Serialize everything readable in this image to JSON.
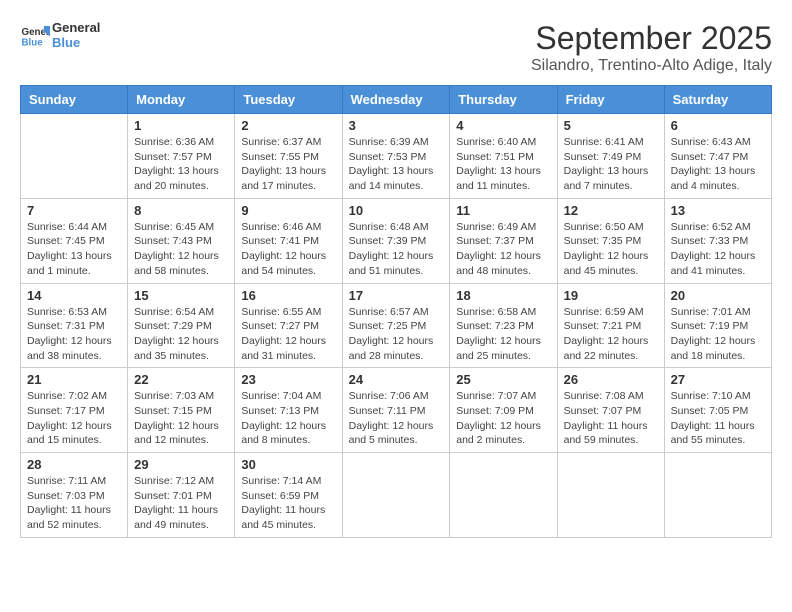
{
  "header": {
    "logo_line1": "General",
    "logo_line2": "Blue",
    "month_title": "September 2025",
    "subtitle": "Silandro, Trentino-Alto Adige, Italy"
  },
  "days_of_week": [
    "Sunday",
    "Monday",
    "Tuesday",
    "Wednesday",
    "Thursday",
    "Friday",
    "Saturday"
  ],
  "weeks": [
    [
      {
        "day": "",
        "info": ""
      },
      {
        "day": "1",
        "info": "Sunrise: 6:36 AM\nSunset: 7:57 PM\nDaylight: 13 hours\nand 20 minutes."
      },
      {
        "day": "2",
        "info": "Sunrise: 6:37 AM\nSunset: 7:55 PM\nDaylight: 13 hours\nand 17 minutes."
      },
      {
        "day": "3",
        "info": "Sunrise: 6:39 AM\nSunset: 7:53 PM\nDaylight: 13 hours\nand 14 minutes."
      },
      {
        "day": "4",
        "info": "Sunrise: 6:40 AM\nSunset: 7:51 PM\nDaylight: 13 hours\nand 11 minutes."
      },
      {
        "day": "5",
        "info": "Sunrise: 6:41 AM\nSunset: 7:49 PM\nDaylight: 13 hours\nand 7 minutes."
      },
      {
        "day": "6",
        "info": "Sunrise: 6:43 AM\nSunset: 7:47 PM\nDaylight: 13 hours\nand 4 minutes."
      }
    ],
    [
      {
        "day": "7",
        "info": "Sunrise: 6:44 AM\nSunset: 7:45 PM\nDaylight: 13 hours\nand 1 minute."
      },
      {
        "day": "8",
        "info": "Sunrise: 6:45 AM\nSunset: 7:43 PM\nDaylight: 12 hours\nand 58 minutes."
      },
      {
        "day": "9",
        "info": "Sunrise: 6:46 AM\nSunset: 7:41 PM\nDaylight: 12 hours\nand 54 minutes."
      },
      {
        "day": "10",
        "info": "Sunrise: 6:48 AM\nSunset: 7:39 PM\nDaylight: 12 hours\nand 51 minutes."
      },
      {
        "day": "11",
        "info": "Sunrise: 6:49 AM\nSunset: 7:37 PM\nDaylight: 12 hours\nand 48 minutes."
      },
      {
        "day": "12",
        "info": "Sunrise: 6:50 AM\nSunset: 7:35 PM\nDaylight: 12 hours\nand 45 minutes."
      },
      {
        "day": "13",
        "info": "Sunrise: 6:52 AM\nSunset: 7:33 PM\nDaylight: 12 hours\nand 41 minutes."
      }
    ],
    [
      {
        "day": "14",
        "info": "Sunrise: 6:53 AM\nSunset: 7:31 PM\nDaylight: 12 hours\nand 38 minutes."
      },
      {
        "day": "15",
        "info": "Sunrise: 6:54 AM\nSunset: 7:29 PM\nDaylight: 12 hours\nand 35 minutes."
      },
      {
        "day": "16",
        "info": "Sunrise: 6:55 AM\nSunset: 7:27 PM\nDaylight: 12 hours\nand 31 minutes."
      },
      {
        "day": "17",
        "info": "Sunrise: 6:57 AM\nSunset: 7:25 PM\nDaylight: 12 hours\nand 28 minutes."
      },
      {
        "day": "18",
        "info": "Sunrise: 6:58 AM\nSunset: 7:23 PM\nDaylight: 12 hours\nand 25 minutes."
      },
      {
        "day": "19",
        "info": "Sunrise: 6:59 AM\nSunset: 7:21 PM\nDaylight: 12 hours\nand 22 minutes."
      },
      {
        "day": "20",
        "info": "Sunrise: 7:01 AM\nSunset: 7:19 PM\nDaylight: 12 hours\nand 18 minutes."
      }
    ],
    [
      {
        "day": "21",
        "info": "Sunrise: 7:02 AM\nSunset: 7:17 PM\nDaylight: 12 hours\nand 15 minutes."
      },
      {
        "day": "22",
        "info": "Sunrise: 7:03 AM\nSunset: 7:15 PM\nDaylight: 12 hours\nand 12 minutes."
      },
      {
        "day": "23",
        "info": "Sunrise: 7:04 AM\nSunset: 7:13 PM\nDaylight: 12 hours\nand 8 minutes."
      },
      {
        "day": "24",
        "info": "Sunrise: 7:06 AM\nSunset: 7:11 PM\nDaylight: 12 hours\nand 5 minutes."
      },
      {
        "day": "25",
        "info": "Sunrise: 7:07 AM\nSunset: 7:09 PM\nDaylight: 12 hours\nand 2 minutes."
      },
      {
        "day": "26",
        "info": "Sunrise: 7:08 AM\nSunset: 7:07 PM\nDaylight: 11 hours\nand 59 minutes."
      },
      {
        "day": "27",
        "info": "Sunrise: 7:10 AM\nSunset: 7:05 PM\nDaylight: 11 hours\nand 55 minutes."
      }
    ],
    [
      {
        "day": "28",
        "info": "Sunrise: 7:11 AM\nSunset: 7:03 PM\nDaylight: 11 hours\nand 52 minutes."
      },
      {
        "day": "29",
        "info": "Sunrise: 7:12 AM\nSunset: 7:01 PM\nDaylight: 11 hours\nand 49 minutes."
      },
      {
        "day": "30",
        "info": "Sunrise: 7:14 AM\nSunset: 6:59 PM\nDaylight: 11 hours\nand 45 minutes."
      },
      {
        "day": "",
        "info": ""
      },
      {
        "day": "",
        "info": ""
      },
      {
        "day": "",
        "info": ""
      },
      {
        "day": "",
        "info": ""
      }
    ]
  ]
}
